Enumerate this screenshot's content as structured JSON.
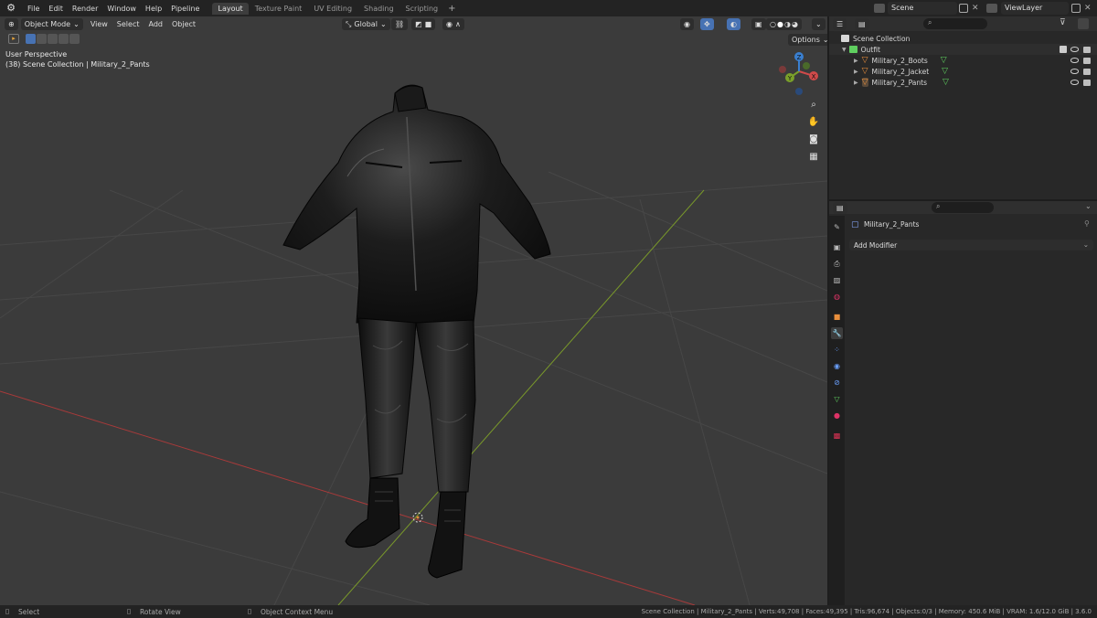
{
  "topbar": {
    "menus": [
      "File",
      "Edit",
      "Render",
      "Window",
      "Help",
      "Pipeline"
    ],
    "workspaces": [
      "Layout",
      "Texture Paint",
      "UV Editing",
      "Shading",
      "Scripting"
    ],
    "active_workspace": "Layout",
    "add_workspace": "+",
    "scene": "Scene",
    "view_layer": "ViewLayer"
  },
  "viewport": {
    "mode": "Object Mode",
    "menus": [
      "View",
      "Select",
      "Add",
      "Object"
    ],
    "orientation": "Global",
    "options": "Options",
    "overlay_line1": "User Perspective",
    "overlay_line2": "(38) Scene Collection | Military_2_Pants",
    "gizmo_axes": {
      "x": "X",
      "y": "Y",
      "z": "Z"
    }
  },
  "outliner": {
    "root": "Scene Collection",
    "collection": "Outfit",
    "objects": [
      "Military_2_Boots",
      "Military_2_Jacket",
      "Military_2_Pants"
    ]
  },
  "properties": {
    "object_name": "Military_2_Pants",
    "add_modifier": "Add Modifier"
  },
  "statusbar": {
    "select": "Select",
    "rotate": "Rotate View",
    "context": "Object Context Menu",
    "stats": "Scene Collection | Military_2_Pants | Verts:49,708 | Faces:49,395 | Tris:96,674 | Objects:0/3 | Memory: 450.6 MiB | VRAM: 1.6/12.0 GiB | 3.6.0"
  },
  "colors": {
    "x_axis": "#a83a3a",
    "y_axis": "#7a9a2a",
    "accent": "#4772b3",
    "collection": "#5fcf5f",
    "mesh": "#e88e3c"
  }
}
